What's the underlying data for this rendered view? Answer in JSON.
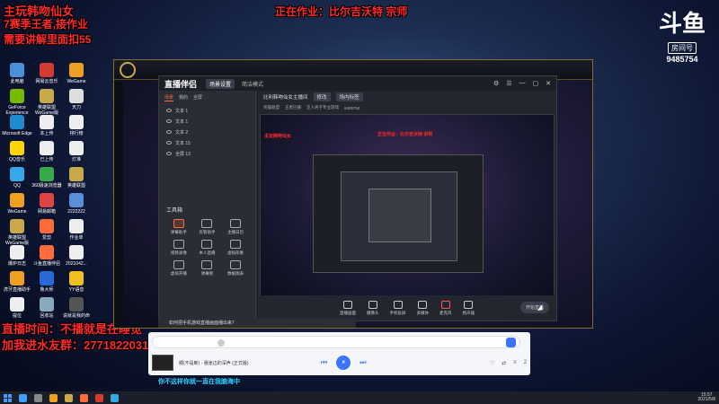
{
  "desktop": {
    "icons": [
      {
        "label": "此电脑",
        "color": "#4a90d9"
      },
      {
        "label": "网易云音乐",
        "color": "#d43c33"
      },
      {
        "label": "WeGame",
        "color": "#f0a020"
      },
      {
        "label": "GeForce Experience",
        "color": "#76b900"
      },
      {
        "label": "英雄联盟 WeGame版",
        "color": "#c8a94a"
      },
      {
        "label": "天刀",
        "color": "#ddd"
      },
      {
        "label": "Microsoft Edge",
        "color": "#1f8ad0"
      },
      {
        "label": "本上传",
        "color": "#eee"
      },
      {
        "label": "排行榜",
        "color": "#eee"
      },
      {
        "label": "QQ音乐",
        "color": "#ffd400"
      },
      {
        "label": "已上传",
        "color": "#eee"
      },
      {
        "label": "灯准",
        "color": "#eee"
      },
      {
        "label": "QQ",
        "color": "#35a8e8"
      },
      {
        "label": "360极速浏览器",
        "color": "#36a948"
      },
      {
        "label": "英雄联盟",
        "color": "#c8a94a"
      },
      {
        "label": "WeGame",
        "color": "#f0a020"
      },
      {
        "label": "网易邮箱",
        "color": "#d44"
      },
      {
        "label": "2222222",
        "color": "#5a8fd8"
      },
      {
        "label": "英雄联盟 WeGame版",
        "color": "#c8a94a"
      },
      {
        "label": "爱剪",
        "color": "#ff6b3a"
      },
      {
        "label": "作业单",
        "color": "#eee"
      },
      {
        "label": "爆炉日志",
        "color": "#eee"
      },
      {
        "label": "斗鱼直播伴侣",
        "color": "#ff6b3a"
      },
      {
        "label": "2021042...",
        "color": "#eee"
      },
      {
        "label": "虎牙直播助手",
        "color": "#f0a020"
      },
      {
        "label": "鲁大师",
        "color": "#2a6ad8"
      },
      {
        "label": "YY语音",
        "color": "#f0c020"
      },
      {
        "label": "提位",
        "color": "#eee"
      },
      {
        "label": "回收站",
        "color": "#8ab"
      },
      {
        "label": "说就是我的命",
        "color": "#555"
      }
    ]
  },
  "overlay": {
    "top_left": [
      "主玩韩吻仙女",
      "7赛季王者,接作业",
      "需要讲解里面扣55"
    ],
    "top_center": "正在作业：比尔吉沃特 宗师",
    "bottom_left_1": "直播时间：不播就是在睡觉",
    "bottom_left_2": "加我进水友群：2771822031"
  },
  "streamer": {
    "logo_text": "斗鱼",
    "room_label": "房间号",
    "room_number": "9485754"
  },
  "app": {
    "brand": "直播伴侣",
    "scene_tabs": [
      "场景",
      "我的",
      "全屏"
    ],
    "header_tabs": [
      "场景设置",
      "简洁模式"
    ],
    "win_controls": [
      "⚙",
      "☰",
      "—",
      "▢",
      "✕"
    ],
    "sources": [
      {
        "label": "文本 1"
      },
      {
        "label": "文本 1"
      },
      {
        "label": "文本 2"
      },
      {
        "label": "文本 15"
      },
      {
        "label": "全屏 13"
      }
    ],
    "tools_title": "工具箱",
    "tools": [
      {
        "label": "弹幕助手",
        "accent": true
      },
      {
        "label": "房管助手",
        "accent": false
      },
      {
        "label": "主播日历",
        "accent": false
      },
      {
        "label": "视频录像",
        "accent": false
      },
      {
        "label": "本人直播",
        "accent": false
      },
      {
        "label": "虚拟形象",
        "accent": false
      },
      {
        "label": "虚拟开播",
        "accent": false
      },
      {
        "label": "弹幕姬",
        "accent": false
      },
      {
        "label": "数据图表",
        "accent": false
      }
    ],
    "room_title": "比利韩吻仙女主播间",
    "room_tag": "修改",
    "room_category": "场内标签",
    "room_sub": [
      "英雄联盟",
      "王者已播",
      "正人男子专业游戏",
      "9485754"
    ],
    "preview_overlays": [
      "正在作业：比尔吉沃特 宗师",
      "主玩韩吻仙女"
    ],
    "bottom_buttons": [
      {
        "label": "直播画面"
      },
      {
        "label": "摄像头"
      },
      {
        "label": "手机投屏"
      },
      {
        "label": "多媒体"
      },
      {
        "label": "麦克风"
      },
      {
        "label": "扬声器"
      }
    ],
    "start_button": "开始直播",
    "notice": "如何把手机游戏直播画面播出来？"
  },
  "music": {
    "song_title": "顺(不是断) - 悬崖边的深声 (正式版)",
    "controls": [
      "⏮",
      "⏸",
      "⏭"
    ],
    "extra": [
      "♡",
      "⇄",
      "≡",
      "2"
    ],
    "lyric": "你不这样你就一直在我脑海中"
  },
  "taskbar": {
    "apps": [
      "#3fa0ff",
      "#888",
      "#f0a020",
      "#c8a94a",
      "#ff6b3a",
      "#d43c33",
      "#35a8e8"
    ],
    "time": "15:57",
    "date": "2021/5/8"
  }
}
